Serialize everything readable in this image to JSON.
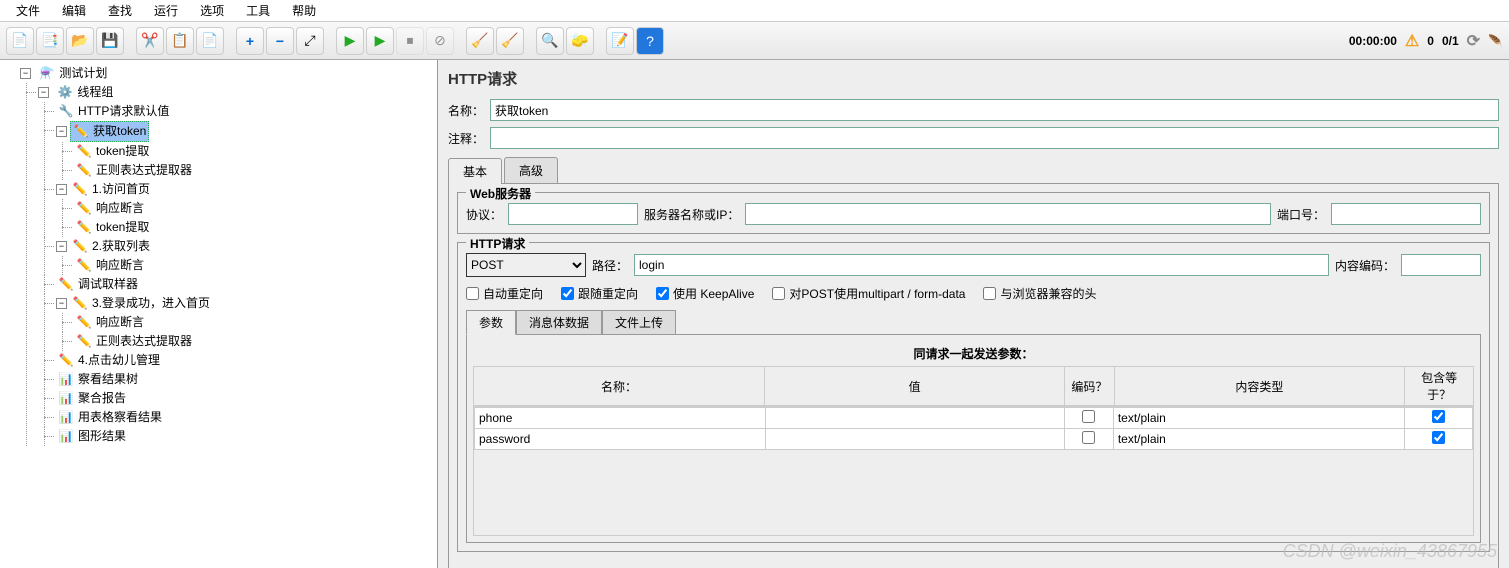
{
  "menu": [
    "文件",
    "编辑",
    "查找",
    "运行",
    "选项",
    "工具",
    "帮助"
  ],
  "toolbar_status": {
    "time": "00:00:00",
    "warnings": "0",
    "threads": "0/1"
  },
  "tree": {
    "root": "测试计划",
    "thread_group": "线程组",
    "items": [
      {
        "label": "HTTP请求默认值",
        "icon": "🔧"
      },
      {
        "label": "获取token",
        "icon": "✏️",
        "selected": true,
        "children": [
          {
            "label": "token提取",
            "icon": "✏️"
          },
          {
            "label": "正则表达式提取器",
            "icon": "✏️"
          }
        ]
      },
      {
        "label": "1.访问首页",
        "icon": "✏️",
        "children": [
          {
            "label": "响应断言",
            "icon": "✏️"
          },
          {
            "label": "token提取",
            "icon": "✏️"
          }
        ]
      },
      {
        "label": "2.获取列表",
        "icon": "✏️",
        "children": [
          {
            "label": "响应断言",
            "icon": "✏️"
          }
        ]
      },
      {
        "label": "调试取样器",
        "icon": "✏️"
      },
      {
        "label": "3.登录成功，进入首页",
        "icon": "✏️",
        "children": [
          {
            "label": "响应断言",
            "icon": "✏️"
          },
          {
            "label": "正则表达式提取器",
            "icon": "✏️"
          }
        ]
      },
      {
        "label": "4.点击幼儿管理",
        "icon": "✏️"
      },
      {
        "label": "察看结果树",
        "icon": "📊"
      },
      {
        "label": "聚合报告",
        "icon": "📊"
      },
      {
        "label": "用表格察看结果",
        "icon": "📊"
      },
      {
        "label": "图形结果",
        "icon": "📊"
      }
    ]
  },
  "panel": {
    "title": "HTTP请求",
    "name_label": "名称：",
    "name_value": "获取token",
    "comment_label": "注释：",
    "comment_value": "",
    "tabs": {
      "basic": "基本",
      "advanced": "高级"
    },
    "web_server": {
      "title": "Web服务器",
      "protocol_label": "协议：",
      "protocol_value": "",
      "server_label": "服务器名称或IP：",
      "server_value": "",
      "port_label": "端口号：",
      "port_value": ""
    },
    "http_request": {
      "title": "HTTP请求",
      "method": "POST",
      "path_label": "路径：",
      "path_value": "login",
      "encoding_label": "内容编码：",
      "encoding_value": "",
      "cb_auto_redirect": "自动重定向",
      "cb_follow_redirect": "跟随重定向",
      "cb_keepalive": "使用 KeepAlive",
      "cb_multipart": "对POST使用multipart / form-data",
      "cb_browser_headers": "与浏览器兼容的头"
    },
    "param_tabs": {
      "params": "参数",
      "body": "消息体数据",
      "files": "文件上传"
    },
    "params_heading": "同请求一起发送参数：",
    "params_table": {
      "headers": {
        "name": "名称：",
        "value": "值",
        "encode": "编码？",
        "content_type": "内容类型",
        "include_equals": "包含等于？"
      },
      "rows": [
        {
          "name": "phone",
          "value": "",
          "encode": false,
          "content_type": "text/plain",
          "include_equals": true
        },
        {
          "name": "password",
          "value": "",
          "encode": false,
          "content_type": "text/plain",
          "include_equals": true
        }
      ]
    }
  },
  "watermark": "CSDN @weixin_43867955"
}
